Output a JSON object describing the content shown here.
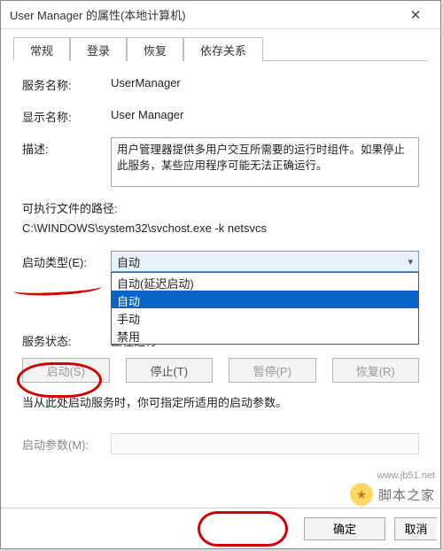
{
  "window": {
    "title": "User Manager 的属性(本地计算机)",
    "close": "✕"
  },
  "tabs": [
    "常规",
    "登录",
    "恢复",
    "依存关系"
  ],
  "active_tab": 0,
  "fields": {
    "service_name_label": "服务名称:",
    "service_name_value": "UserManager",
    "display_name_label": "显示名称:",
    "display_name_value": "User Manager",
    "description_label": "描述:",
    "description_value": "用户管理器提供多用户交互所需要的运行时组件。如果停止此服务，某些应用程序可能无法正确运行。",
    "exe_path_label": "可执行文件的路径:",
    "exe_path_value": "C:\\WINDOWS\\system32\\svchost.exe -k netsvcs",
    "startup_type_label": "启动类型(E):",
    "startup_type_selected": "自动",
    "startup_type_options": [
      "自动(延迟启动)",
      "自动",
      "手动",
      "禁用"
    ],
    "startup_type_highlight_index": 1,
    "service_status_label": "服务状态:",
    "service_status_value": "正在运行"
  },
  "buttons": {
    "start": "启动(S)",
    "stop": "停止(T)",
    "pause": "暂停(P)",
    "resume": "恢复(R)"
  },
  "note": "当从此处启动服务时，你可指定所适用的启动参数。",
  "start_params_label": "启动参数(M):",
  "footer": {
    "ok": "确定",
    "cancel": "取消"
  },
  "watermark": {
    "url": "www.jb51.net",
    "text": "脚本之家"
  }
}
